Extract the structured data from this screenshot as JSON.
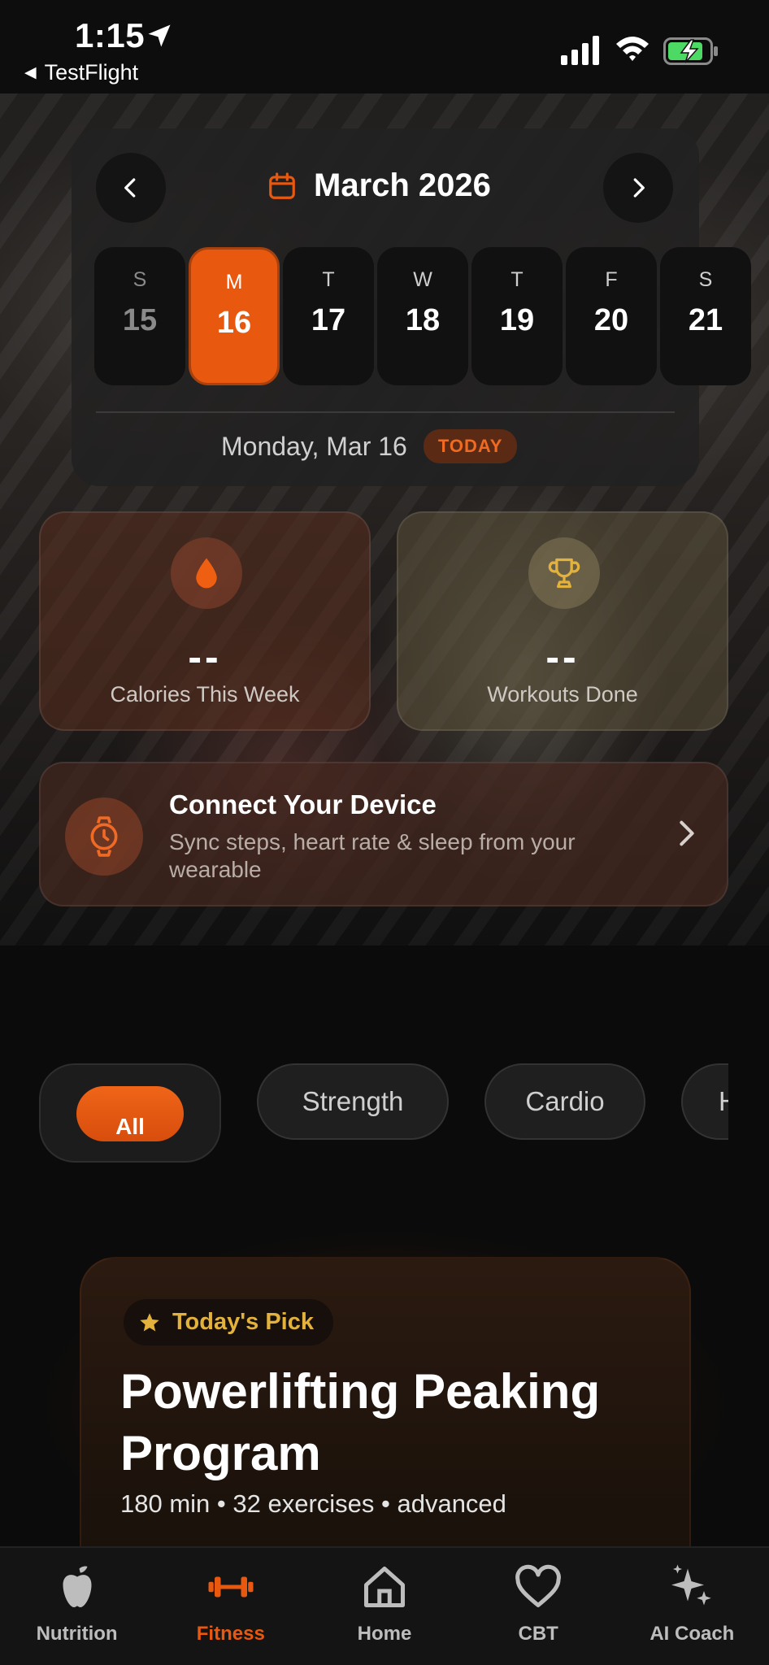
{
  "status_bar": {
    "time": "1:15",
    "back_app": "TestFlight"
  },
  "calendar": {
    "month_title": "March 2026",
    "days": [
      {
        "letter": "S",
        "number": "15"
      },
      {
        "letter": "M",
        "number": "16"
      },
      {
        "letter": "T",
        "number": "17"
      },
      {
        "letter": "W",
        "number": "18"
      },
      {
        "letter": "T",
        "number": "19"
      },
      {
        "letter": "F",
        "number": "20"
      },
      {
        "letter": "S",
        "number": "21"
      }
    ],
    "selected_date": "Monday, Mar 16",
    "today_badge": "TODAY"
  },
  "stats": {
    "calories": {
      "value": "--",
      "label": "Calories This Week",
      "icon": "flame-icon"
    },
    "workouts": {
      "value": "--",
      "label": "Workouts Done",
      "icon": "trophy-icon"
    }
  },
  "device": {
    "title": "Connect Your Device",
    "subtitle": "Sync steps, heart rate & sleep from your wearable"
  },
  "filters": {
    "items": [
      "All",
      "Strength",
      "Cardio",
      "H"
    ]
  },
  "todays_pick": {
    "badge": "Today's Pick",
    "title": "Powerlifting Peaking Program",
    "meta": "180 min • 32 exercises • advanced"
  },
  "tabbar": {
    "items": [
      {
        "label": "Nutrition",
        "icon": "apple-icon"
      },
      {
        "label": "Fitness",
        "icon": "dumbbell-icon"
      },
      {
        "label": "Home",
        "icon": "home-icon"
      },
      {
        "label": "CBT",
        "icon": "heart-icon"
      },
      {
        "label": "AI Coach",
        "icon": "sparkles-icon"
      }
    ]
  },
  "colors": {
    "accent": "#e8590f",
    "gold": "#e3b23c",
    "background": "#0b0b0b"
  }
}
